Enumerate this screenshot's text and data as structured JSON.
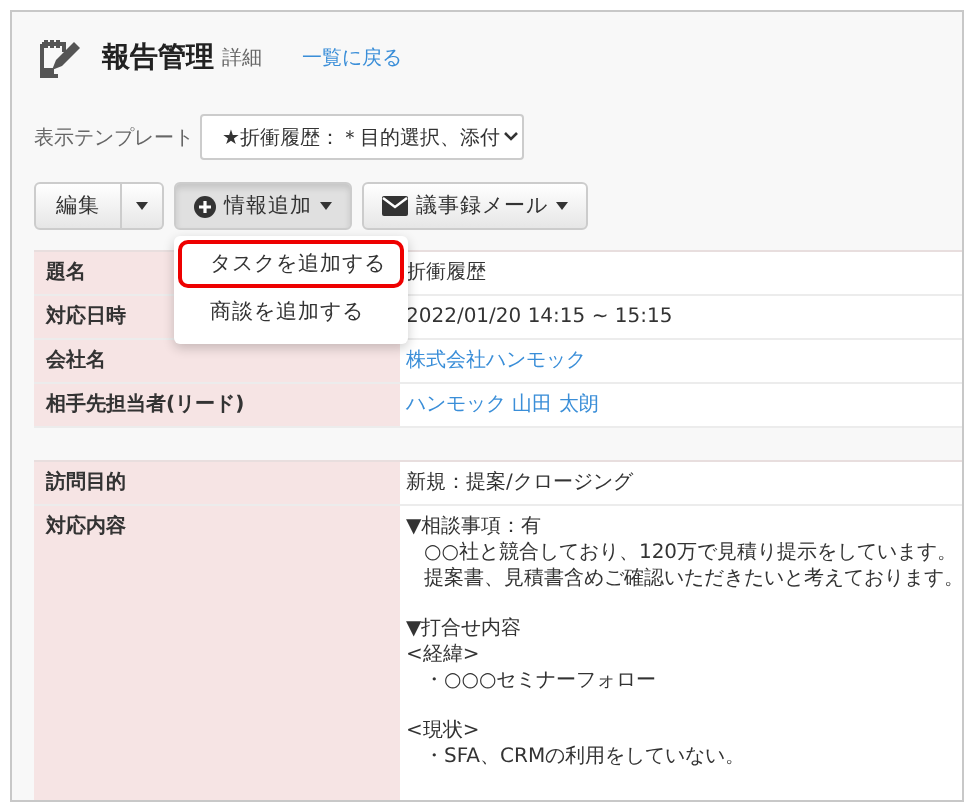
{
  "header": {
    "title": "報告管理",
    "subtitle": "詳細",
    "back_link": "一覧に戻る"
  },
  "template": {
    "label": "表示テンプレート",
    "value": "★折衝履歴：＊目的選択、添付"
  },
  "toolbar": [
    {
      "kind": "split",
      "label": "編集"
    },
    {
      "kind": "add-menu",
      "label": "情報追加",
      "open": true
    },
    {
      "kind": "mail-menu",
      "label": "議事録メール",
      "open": false
    }
  ],
  "dropdown_menu": [
    {
      "label": "タスクを追加する",
      "highlighted": true
    },
    {
      "label": "商談を追加する",
      "highlighted": false
    }
  ],
  "tables": [
    {
      "rows": [
        {
          "label": "題名",
          "value": "折衝履歴",
          "kind": "text"
        },
        {
          "label": "対応日時",
          "value": "2022/01/20 14:15 ~ 15:15",
          "kind": "text"
        },
        {
          "label": "会社名",
          "value": "株式会社ハンモック",
          "kind": "link"
        },
        {
          "label": "相手先担当者(リード)",
          "value": "ハンモック 山田 太朗",
          "kind": "link"
        }
      ]
    },
    {
      "rows": [
        {
          "label": "訪問目的",
          "value": "新規：提案/クロージング",
          "kind": "text"
        },
        {
          "label": "対応内容",
          "kind": "lines",
          "paragraphs": [
            [
              {
                "text": "▼相談事項：有",
                "indented": false
              },
              {
                "text": "○○社と競合しており、120万で見積り提示をしています。",
                "indented": true
              },
              {
                "text": "提案書、見積書含めご確認いただきたいと考えております。",
                "indented": true
              }
            ],
            [
              {
                "text": "▼打合せ内容",
                "indented": false
              },
              {
                "text": "<経緯>",
                "indented": false
              },
              {
                "text": "・○○○セミナーフォロー",
                "indented": true
              }
            ],
            [
              {
                "text": "<現状>",
                "indented": false
              },
              {
                "text": "・SFA、CRMの利用をしていない。",
                "indented": true
              }
            ]
          ]
        }
      ]
    }
  ]
}
